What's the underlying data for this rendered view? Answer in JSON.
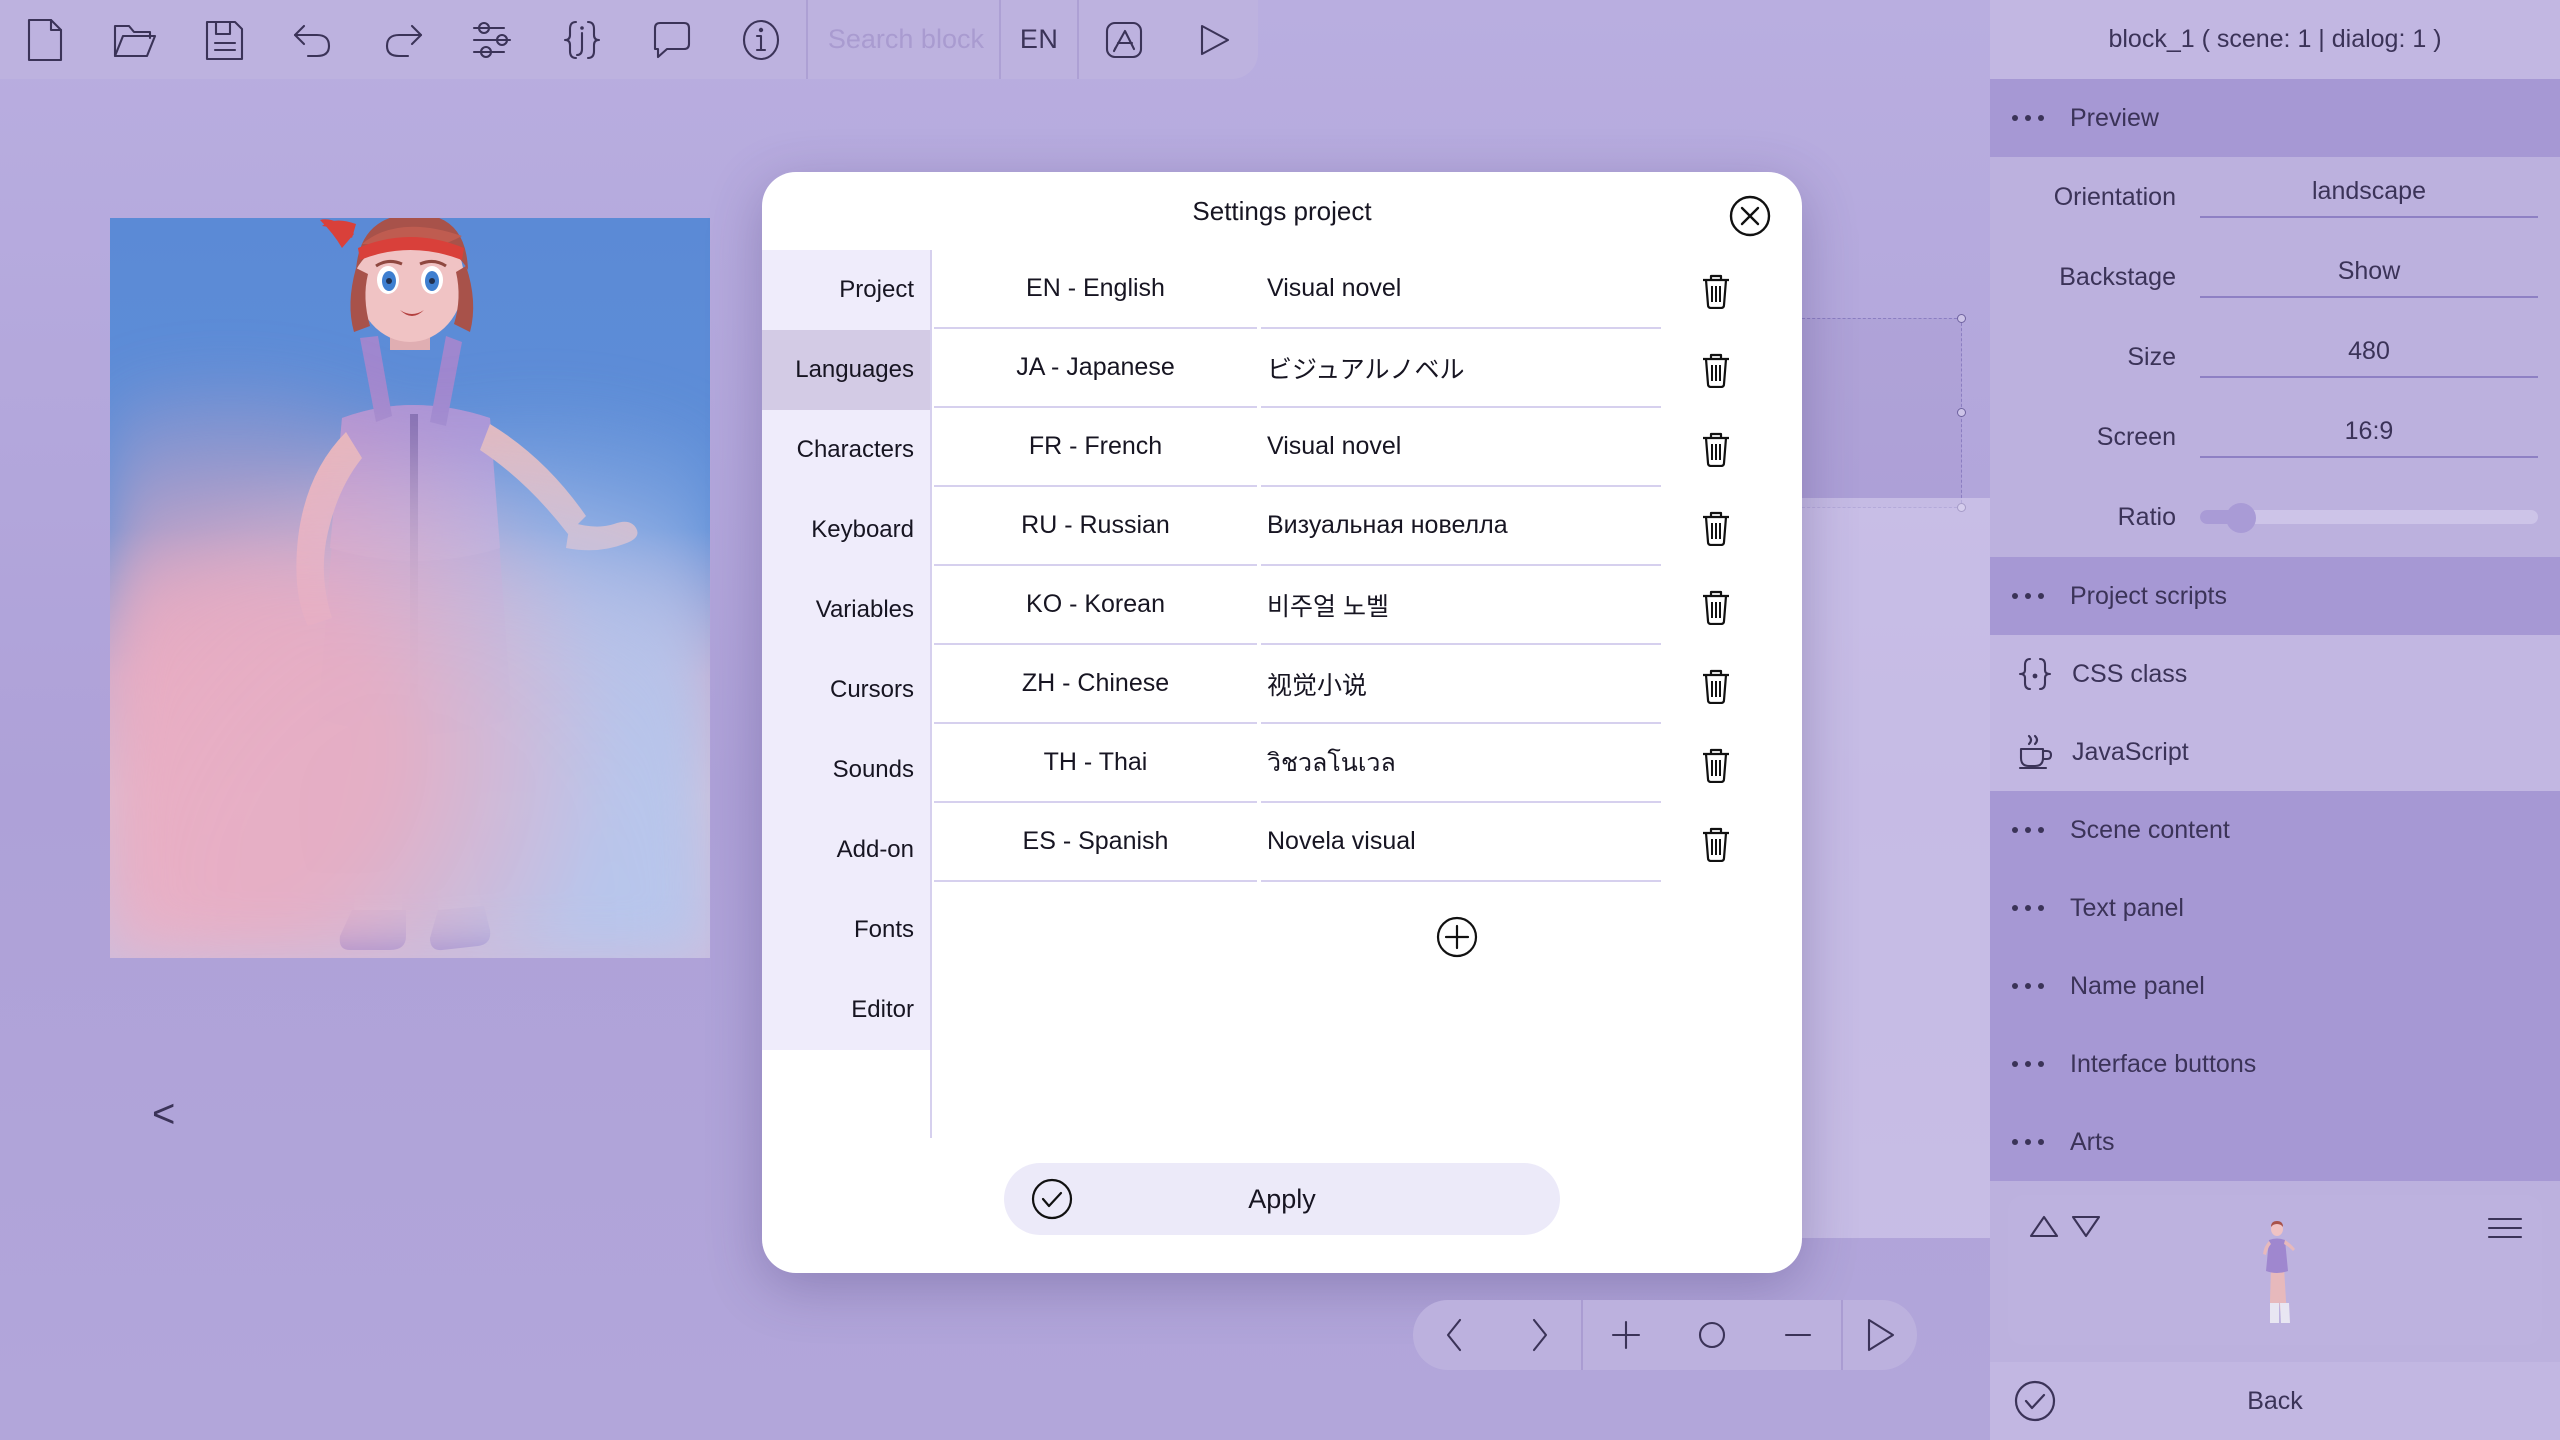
{
  "toolbar": {
    "buttons": [
      {
        "name": "new-file-icon",
        "label": "New"
      },
      {
        "name": "open-folder-icon",
        "label": "Open"
      },
      {
        "name": "save-icon",
        "label": "Save"
      },
      {
        "name": "undo-icon",
        "label": "Undo"
      },
      {
        "name": "redo-icon",
        "label": "Redo"
      },
      {
        "name": "sliders-icon",
        "label": "Settings"
      },
      {
        "name": "json-icon",
        "label": "JSON"
      },
      {
        "name": "comment-icon",
        "label": "Comment"
      },
      {
        "name": "info-icon",
        "label": "Info"
      }
    ],
    "search_placeholder": "Search block",
    "language": "EN",
    "app_icon": "app-store-icon",
    "play_icon": "play-icon",
    "back_arrow": "<"
  },
  "modal": {
    "title": "Settings project",
    "close_icon": "close-icon",
    "sidebar": [
      {
        "label": "Project",
        "selected": false
      },
      {
        "label": "Languages",
        "selected": true
      },
      {
        "label": "Characters",
        "selected": false
      },
      {
        "label": "Keyboard",
        "selected": false
      },
      {
        "label": "Variables",
        "selected": false
      },
      {
        "label": "Cursors",
        "selected": false
      },
      {
        "label": "Sounds",
        "selected": false
      },
      {
        "label": "Add-on",
        "selected": false
      },
      {
        "label": "Fonts",
        "selected": false
      },
      {
        "label": "Editor",
        "selected": false
      }
    ],
    "languages": [
      {
        "code": "EN - English",
        "title": "Visual novel"
      },
      {
        "code": "JA - Japanese",
        "title": "ビジュアルノベル"
      },
      {
        "code": "FR - French",
        "title": "Visual novel"
      },
      {
        "code": "RU - Russian",
        "title": "Визуальная новелла"
      },
      {
        "code": "KO - Korean",
        "title": "비주얼 노벨"
      },
      {
        "code": "ZH - Chinese",
        "title": "视觉小说"
      },
      {
        "code": "TH - Thai",
        "title": "วิชวลโนเวล"
      },
      {
        "code": "ES - Spanish",
        "title": "Novela visual"
      }
    ],
    "delete_icon": "trash-icon",
    "add_icon": "plus-circle-icon",
    "apply_label": "Apply",
    "apply_icon": "check-circle-icon"
  },
  "bottom_bar": {
    "buttons": [
      {
        "name": "prev-block-icon"
      },
      {
        "name": "next-block-icon"
      },
      {
        "name": "add-block-icon"
      },
      {
        "name": "circle-block-icon"
      },
      {
        "name": "remove-block-icon"
      },
      {
        "name": "play-preview-icon"
      }
    ]
  },
  "right_panel": {
    "title": "block_1 ( scene: 1 | dialog: 1 )",
    "preview_header": "Preview",
    "preview_props": [
      {
        "label": "Orientation",
        "value": "landscape"
      },
      {
        "label": "Backstage",
        "value": "Show"
      },
      {
        "label": "Size",
        "value": "480"
      },
      {
        "label": "Screen",
        "value": "16:9"
      }
    ],
    "ratio_label": "Ratio",
    "ratio_percent": 12,
    "scripts_header": "Project scripts",
    "scripts": [
      {
        "label": "CSS class",
        "icon": "css-braces-icon"
      },
      {
        "label": "JavaScript",
        "icon": "coffee-cup-icon"
      }
    ],
    "sections": [
      {
        "label": "Scene content"
      },
      {
        "label": "Text panel"
      },
      {
        "label": "Name panel"
      },
      {
        "label": "Interface buttons"
      },
      {
        "label": "Arts"
      }
    ],
    "assets": {
      "up_icon": "triangle-up-icon",
      "down_icon": "triangle-down-icon",
      "menu_icon": "hamburger-menu-icon",
      "thumb_name": "character-thumbnail"
    },
    "back_label": "Back",
    "back_icon": "check-circle-icon"
  },
  "colors": {
    "panel": "#bcb1de",
    "panel_dark": "#a698d4",
    "accent": "#3b3358",
    "modal_bg": "#ffffff",
    "divider": "#d6d0ee",
    "sidebar_item": "#efecfb",
    "sidebar_selected": "#d3cbe5",
    "apply_bg": "#eceaf9"
  }
}
